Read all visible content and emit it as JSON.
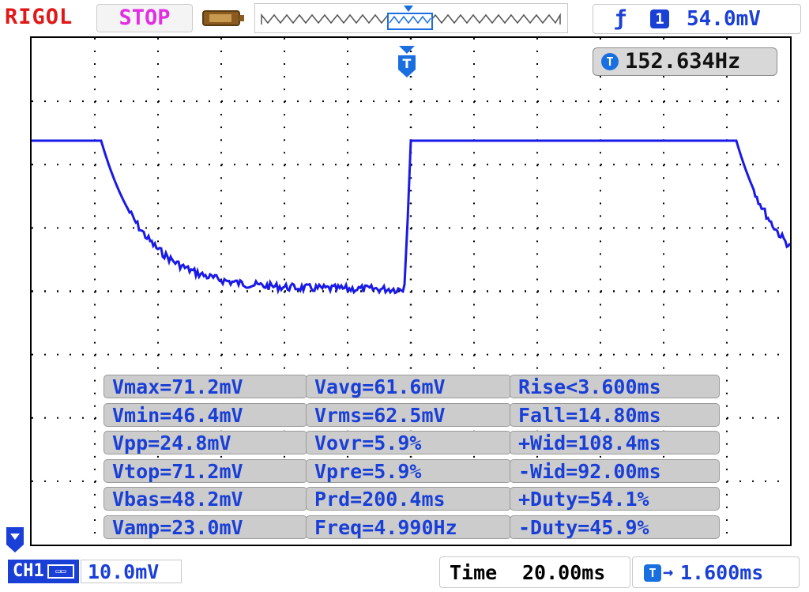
{
  "header": {
    "brand": "RIGOL",
    "run_state": "STOP",
    "trigger": {
      "edge_symbol": "ƒ",
      "source": "1",
      "level": "54.0mV"
    }
  },
  "screen": {
    "trigger_marker": "T",
    "frequency_counter": {
      "icon": "T",
      "value": "152.634Hz"
    }
  },
  "measurements": [
    [
      "Vmax=71.2mV",
      "Vavg=61.6mV",
      "Rise<3.600ms"
    ],
    [
      "Vmin=46.4mV",
      "Vrms=62.5mV",
      "Fall=14.80ms"
    ],
    [
      "Vpp=24.8mV",
      "Vovr=5.9%",
      "+Wid=108.4ms"
    ],
    [
      "Vtop=71.2mV",
      "Vpre=5.9%",
      "-Wid=92.00ms"
    ],
    [
      "Vbas=48.2mV",
      "Prd=200.4ms",
      "+Duty=54.1%"
    ],
    [
      "Vamp=23.0mV",
      "Freq=4.990Hz",
      "-Duty=45.9%"
    ]
  ],
  "footer": {
    "channel_label": "CH1",
    "bandwidth_icon": "bw-limit-icon",
    "volts_per_div": "10.0mV",
    "time_label": "Time",
    "time_per_div": "20.00ms",
    "offset_icon": "T",
    "trigger_offset": "1.600ms"
  },
  "colors": {
    "trace": "#1a1ae6",
    "accent": "#1a3fd6",
    "brand": "#e01818",
    "stop": "#e22ee2"
  }
}
